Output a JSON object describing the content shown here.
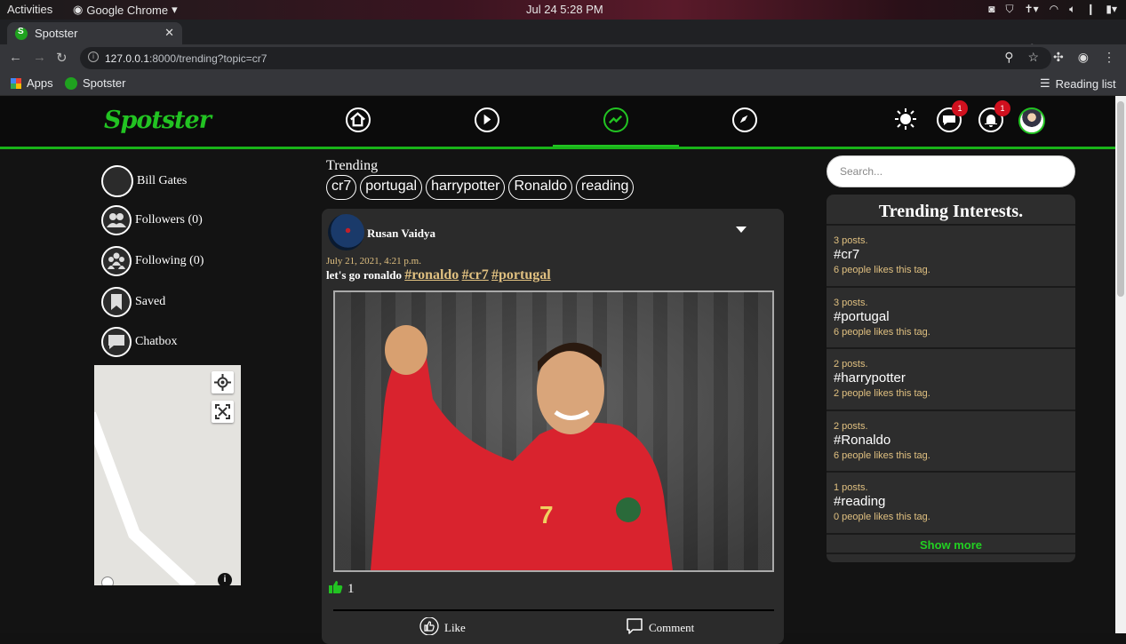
{
  "os": {
    "activities": "Activities",
    "app": "Google Chrome",
    "clock": "Jul 24  5:28 PM"
  },
  "browser": {
    "tab_title": "Spotster",
    "url_host": "127.0.0.1",
    "url_rest": ":8000/trending?topic=cr7",
    "bookmark_apps": "Apps",
    "bookmark_site": "Spotster",
    "reading_list": "Reading list"
  },
  "site": {
    "logo": "Spotster",
    "messages_badge": "1",
    "notifications_badge": "1",
    "sidebar": {
      "user": "Bill Gates",
      "followers": "Followers (0)",
      "following": "Following (0)",
      "saved": "Saved",
      "chatbox": "Chatbox"
    },
    "trending_label": "Trending",
    "trending_pills": [
      "cr7",
      "portugal",
      "harrypotter",
      "Ronaldo",
      "reading"
    ],
    "post": {
      "author": "Rusan Vaidya",
      "date": "July 21, 2021, 4:21 p.m.",
      "text": "let's go ronaldo",
      "tags": [
        "#ronaldo",
        "#cr7",
        "#portugal"
      ],
      "likes": "1",
      "like_label": "Like",
      "comment_label": "Comment"
    },
    "search_placeholder": "Search...",
    "interests": {
      "title": "Trending Interests.",
      "items": [
        {
          "posts": "3 posts.",
          "tag": "#cr7",
          "likes": "6 people likes this tag."
        },
        {
          "posts": "3 posts.",
          "tag": "#portugal",
          "likes": "6 people likes this tag."
        },
        {
          "posts": "2 posts.",
          "tag": "#harrypotter",
          "likes": "2 people likes this tag."
        },
        {
          "posts": "2 posts.",
          "tag": "#Ronaldo",
          "likes": "6 people likes this tag."
        },
        {
          "posts": "1 posts.",
          "tag": "#reading",
          "likes": "0 people likes this tag."
        }
      ],
      "show_more": "Show more"
    }
  }
}
